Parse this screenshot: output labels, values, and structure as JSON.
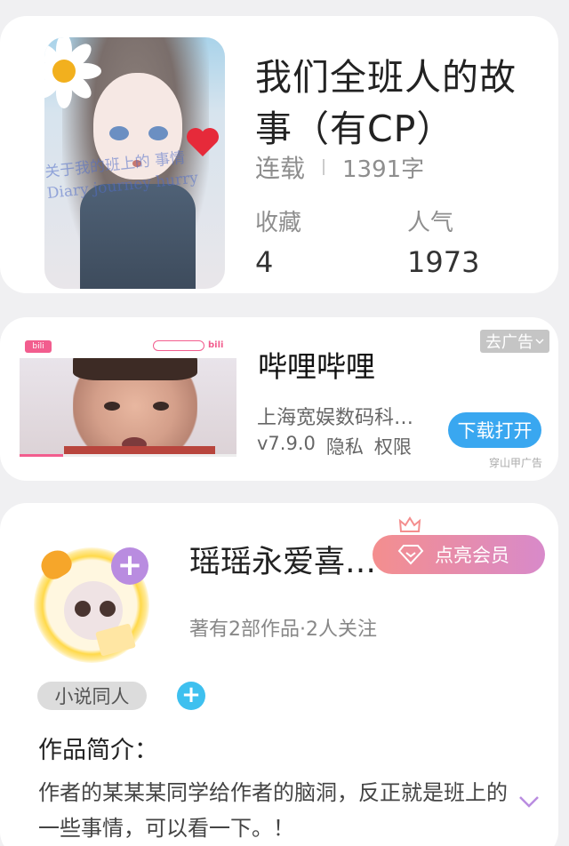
{
  "book": {
    "cover_scribble": "关于我的班上的 事情 Diary journey hurry",
    "title": "我们全班人的故事（有CP）",
    "status": "连载",
    "word_count": "1391字",
    "favorites_label": "收藏",
    "favorites_value": "4",
    "popularity_label": "人气",
    "popularity_value": "1973"
  },
  "ad": {
    "thumb_logo_left": "bili",
    "thumb_logo_right": "bili",
    "app_name": "哔哩哔哩",
    "company": "上海宽娱数码科…",
    "version": "v7.9.0",
    "privacy": "隐私",
    "permissions": "权限",
    "close_label": "去广告",
    "download_label": "下载打开",
    "source": "穿山甲广告",
    "video_progress": 0.2
  },
  "author": {
    "name": "瑶瑶永爱喜…",
    "stats": "著有2部作品·2人关注",
    "vip_label": "点亮会员",
    "tag": "小说同人",
    "intro_heading": "作品简介：",
    "intro_text": "作者的某某某同学给作者的脑洞，反正就是班上的一些事情，可以看一下。！"
  },
  "colors": {
    "accent_blue": "#39a7f0",
    "avatar_plus": "#b98ce0",
    "tag_plus": "#3ec0ef",
    "vip_gradient_start": "#f48e8e",
    "vip_gradient_end": "#d88aca"
  }
}
